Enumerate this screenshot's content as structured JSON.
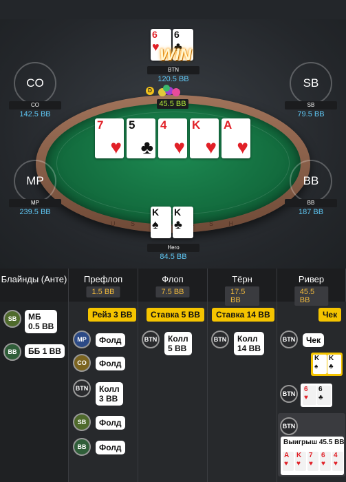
{
  "table": {
    "rail_text": "U S H C A S H",
    "win_label": "WIN",
    "dealer_label": "D",
    "pot": "45.5 BB",
    "board": [
      {
        "rank": "7",
        "suit": "♥",
        "color": "red"
      },
      {
        "rank": "5",
        "suit": "♣",
        "color": "blk"
      },
      {
        "rank": "4",
        "suit": "♥",
        "color": "red"
      },
      {
        "rank": "K",
        "suit": "♥",
        "color": "red"
      },
      {
        "rank": "A",
        "suit": "♥",
        "color": "red"
      }
    ],
    "seats": {
      "btn": {
        "name": "BTN",
        "stack": "120.5 BB",
        "cards": [
          {
            "rank": "6",
            "suit": "♥",
            "color": "red"
          },
          {
            "rank": "6",
            "suit": "♣",
            "color": "blk"
          }
        ]
      },
      "co": {
        "avatar": "CO",
        "name": "CO",
        "stack": "142.5 BB",
        "color": "#7b6420"
      },
      "sb": {
        "avatar": "SB",
        "name": "SB",
        "stack": "79.5 BB",
        "color": "#4f6a2c"
      },
      "mp": {
        "avatar": "MP",
        "name": "MP",
        "stack": "239.5 BB",
        "color": "#2c4a86"
      },
      "bb": {
        "avatar": "BB",
        "name": "BB",
        "stack": "187 BB",
        "color": "#2f5e39"
      },
      "hero": {
        "name": "Hero",
        "stack": "84.5 BB",
        "cards": [
          {
            "rank": "K",
            "suit": "♠",
            "color": "blk"
          },
          {
            "rank": "K",
            "suit": "♣",
            "color": "blk"
          }
        ]
      }
    }
  },
  "history": {
    "columns": [
      {
        "title": "Блайнды (Анте)",
        "pot": ""
      },
      {
        "title": "Префлоп",
        "pot": "1.5 BB"
      },
      {
        "title": "Флоп",
        "pot": "7.5 BB"
      },
      {
        "title": "Тёрн",
        "pot": "17.5 BB"
      },
      {
        "title": "Ривер",
        "pot": "45.5 BB"
      }
    ],
    "blinds": [
      {
        "pos": "SB",
        "text_l1": "МБ",
        "text_l2": "0.5 BB"
      },
      {
        "pos": "BB",
        "text_l1": "ББ 1 BB",
        "text_l2": ""
      }
    ],
    "preflop": {
      "tag": "Рейз 3 BB",
      "actions": [
        {
          "pos": "MP",
          "text_l1": "Фолд",
          "text_l2": ""
        },
        {
          "pos": "CO",
          "text_l1": "Фолд",
          "text_l2": ""
        },
        {
          "pos": "BTN",
          "text_l1": "Колл",
          "text_l2": "3 BB"
        },
        {
          "pos": "SB",
          "text_l1": "Фолд",
          "text_l2": ""
        },
        {
          "pos": "BB",
          "text_l1": "Фолд",
          "text_l2": ""
        }
      ]
    },
    "flop": {
      "tag": "Ставка 5 BB",
      "actions": [
        {
          "pos": "BTN",
          "text_l1": "Колл",
          "text_l2": "5 BB"
        }
      ]
    },
    "turn": {
      "tag": "Ставка 14 BB",
      "actions": [
        {
          "pos": "BTN",
          "text_l1": "Колл",
          "text_l2": "14 BB"
        }
      ]
    },
    "river": {
      "tag": "Чек",
      "actions": [
        {
          "pos": "BTN",
          "text_l1": "Чек",
          "text_l2": ""
        }
      ],
      "hero_show": [
        {
          "rank": "K",
          "suit": "♠",
          "color": "blk"
        },
        {
          "rank": "K",
          "suit": "♣",
          "color": "blk"
        }
      ],
      "btn_show": [
        {
          "rank": "6",
          "suit": "♥",
          "color": "red"
        },
        {
          "rank": "6",
          "suit": "♣",
          "color": "blk"
        }
      ],
      "winner_pos": "BTN",
      "winner_text": "Выигрыш 45.5 BB",
      "winner_hand": [
        {
          "rank": "A",
          "suit": "♥",
          "color": "red"
        },
        {
          "rank": "K",
          "suit": "♥",
          "color": "red"
        },
        {
          "rank": "7",
          "suit": "♥",
          "color": "red"
        },
        {
          "rank": "6",
          "suit": "♥",
          "color": "red"
        },
        {
          "rank": "4",
          "suit": "♥",
          "color": "red"
        }
      ]
    },
    "pos_colors": {
      "SB": "#4f6a2c",
      "BB": "#2f5e39",
      "MP": "#2c4a86",
      "CO": "#7b6420",
      "BTN": "#2a2b2e"
    }
  }
}
